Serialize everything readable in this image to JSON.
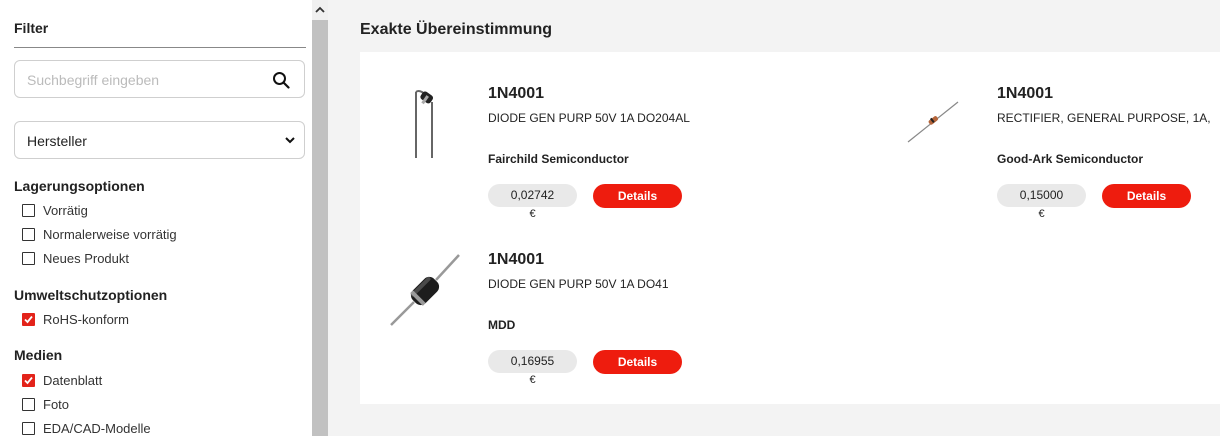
{
  "sidebar": {
    "title": "Filter",
    "search": {
      "placeholder": "Suchbegriff eingeben",
      "value": ""
    },
    "manufacturer_select": {
      "selected": "Hersteller"
    },
    "sections": {
      "stock": {
        "title": "Lagerungsoptionen",
        "options": [
          {
            "label": "Vorrätig",
            "checked": false
          },
          {
            "label": "Normalerweise vorrätig",
            "checked": false
          },
          {
            "label": "Neues Produkt",
            "checked": false
          }
        ]
      },
      "env": {
        "title": "Umweltschutzoptionen",
        "options": [
          {
            "label": "RoHS-konform",
            "checked": true
          }
        ]
      },
      "media": {
        "title": "Medien",
        "options": [
          {
            "label": "Datenblatt",
            "checked": true
          },
          {
            "label": "Foto",
            "checked": false
          },
          {
            "label": "EDA/CAD-Modelle",
            "checked": false
          }
        ]
      }
    }
  },
  "main": {
    "title": "Exakte Übereinstimmung",
    "results": [
      {
        "part_number": "1N4001",
        "description": "DIODE GEN PURP 50V 1A DO204AL",
        "manufacturer": "Fairchild Semiconductor",
        "price": "0,02742",
        "currency": "€",
        "details_label": "Details",
        "image_icon": "axial-diode-bent-leads-image"
      },
      {
        "part_number": "1N4001",
        "description": "RECTIFIER, GENERAL PURPOSE, 1A,",
        "manufacturer": "Good-Ark Semiconductor",
        "price": "0,15000",
        "currency": "€",
        "details_label": "Details",
        "image_icon": "axial-diode-small-image"
      },
      {
        "part_number": "1N4001",
        "description": "DIODE GEN PURP 50V 1A DO41",
        "manufacturer": "MDD",
        "price": "0,16955",
        "currency": "€",
        "details_label": "Details",
        "image_icon": "axial-diode-black-image"
      }
    ]
  },
  "colors": {
    "accent_red": "#ee1c0e",
    "checkbox_checked": "#e3231a",
    "price_pill": "#e9e9e9",
    "page_bg": "#f3f3f3"
  }
}
